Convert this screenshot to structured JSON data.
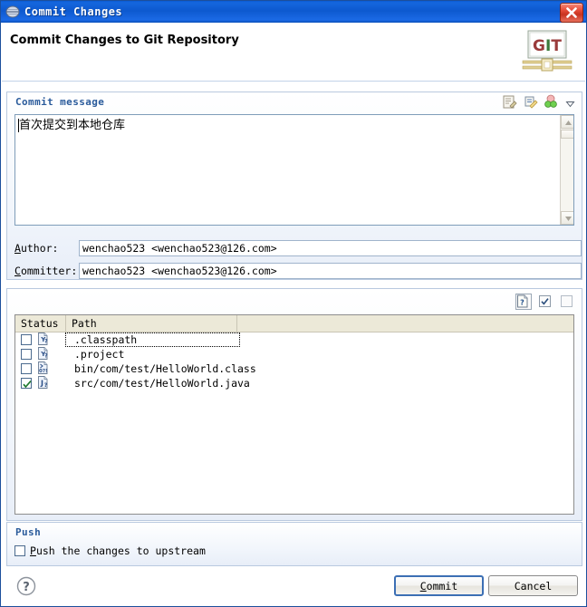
{
  "window": {
    "title": "Commit Changes",
    "icon": "git-disc-icon",
    "close_label": "Close"
  },
  "header": {
    "title": "Commit Changes to Git Repository",
    "logo_text": "GIT"
  },
  "commit_message": {
    "group_title": "Commit message",
    "text": "首次提交到本地仓库",
    "toolbar": [
      {
        "name": "amend-commit-icon",
        "tooltip": "Amend previous commit"
      },
      {
        "name": "signed-off-icon",
        "tooltip": "Add Signed-off-by"
      },
      {
        "name": "change-id-icon",
        "tooltip": "Insert Change-Id"
      },
      {
        "name": "chevron-down-icon",
        "tooltip": "More"
      }
    ]
  },
  "author": {
    "label": "Author:",
    "label_accel": "A",
    "value": "wenchao523 <wenchao523@126.com>"
  },
  "committer": {
    "label": "Committer:",
    "label_accel": "C",
    "value": "wenchao523 <wenchao523@126.com>"
  },
  "files": {
    "toolbar": [
      {
        "name": "show-untracked-icon",
        "tooltip": "Show untracked files",
        "pressed": true
      },
      {
        "name": "select-all-icon",
        "tooltip": "Select all",
        "pressed": false
      },
      {
        "name": "deselect-all-icon",
        "tooltip": "Deselect all",
        "pressed": false
      }
    ],
    "columns": [
      "Status",
      "Path"
    ],
    "rows": [
      {
        "checked": false,
        "status_icon": "untracked-file-icon",
        "path": ".classpath",
        "focused": true
      },
      {
        "checked": false,
        "status_icon": "untracked-file-icon",
        "path": ".project",
        "focused": false
      },
      {
        "checked": false,
        "status_icon": "untracked-binary-icon",
        "path": "bin/com/test/HelloWorld.class",
        "focused": false
      },
      {
        "checked": true,
        "status_icon": "untracked-java-icon",
        "path": "src/com/test/HelloWorld.java",
        "focused": false
      }
    ]
  },
  "push": {
    "group_title": "Push",
    "checkbox_label": "Push the changes to upstream",
    "checkbox_accel": "P",
    "checked": false
  },
  "footer": {
    "help_icon": "help-question-icon",
    "commit_label": "Commit",
    "commit_accel": "C",
    "cancel_label": "Cancel",
    "commit_is_default": true
  },
  "colors": {
    "titlebar_blue": "#0d59cf",
    "group_title_blue": "#2a5b9b",
    "close_red": "#e44b37",
    "header_border": "#c3d3e8",
    "table_header": "#ece9d8",
    "default_button_border": "#3c6fb4"
  }
}
